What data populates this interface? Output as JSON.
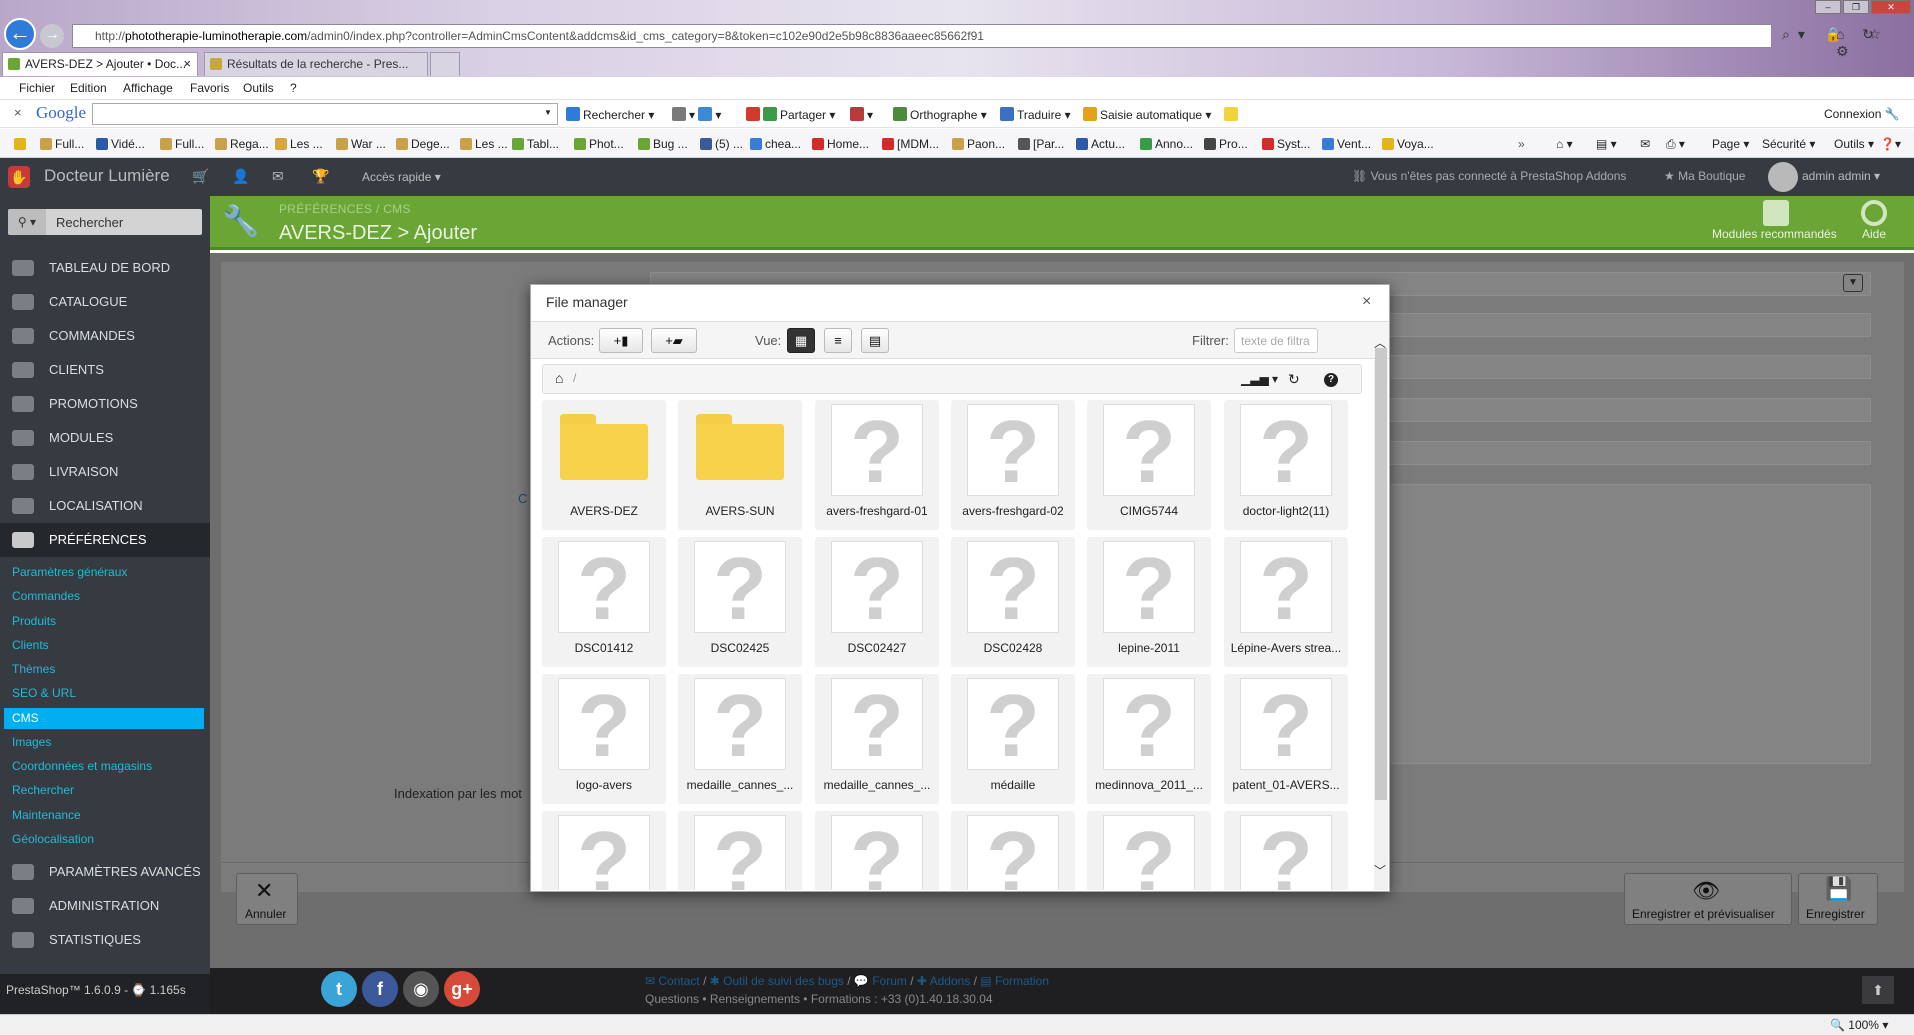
{
  "browser": {
    "url_prefix": "http://",
    "url_host": "phototherapie-luminotherapie.com",
    "url_path": "/admin0/index.php?controller=AdminCmsContent&addcms&id_cms_category=8&token=c102e90d2e5b98c8836aaeec85662f91",
    "tabs": [
      {
        "label": "AVERS-DEZ > Ajouter • Doc...",
        "active": true
      },
      {
        "label": "Résultats de la recherche - Pres...",
        "active": false
      }
    ],
    "tab_close": "×",
    "menu": [
      "Fichier",
      "Edition",
      "Affichage",
      "Favoris",
      "Outils",
      "?"
    ]
  },
  "google_toolbar": {
    "close": "×",
    "logo": "Google",
    "search_value": "",
    "tools": [
      "Rechercher",
      "Partager",
      "Orthographe",
      "Traduire",
      "Saisie automatique"
    ],
    "connexion": "Connexion"
  },
  "bookmarks": [
    "Full...",
    "Vidé...",
    "Full...",
    "Rega...",
    "Les ...",
    "War ...",
    "Dege...",
    "Les ...",
    "Tabl...",
    "Phot...",
    "Bug ...",
    "(5) ...",
    "chea...",
    "Home...",
    "[MDM...",
    "Paon...",
    "[Par...",
    "Actu...",
    "Anno...",
    "Pro...",
    "Syst...",
    "Vent...",
    "Voya..."
  ],
  "browser_right_tools": [
    "Page",
    "Sécurité",
    "Outils"
  ],
  "admin": {
    "shop_name": "Docteur Lumière",
    "quick_access": "Accès rapide",
    "addons_status": "Vous n'êtes pas connecté à PrestaShop Addons",
    "my_shop": "Ma Boutique",
    "user": "admin admin"
  },
  "sidebar": {
    "search_placeholder": "Rechercher",
    "items": [
      {
        "label": "TABLEAU DE BORD"
      },
      {
        "label": "CATALOGUE"
      },
      {
        "label": "COMMANDES"
      },
      {
        "label": "CLIENTS"
      },
      {
        "label": "PROMOTIONS"
      },
      {
        "label": "MODULES"
      },
      {
        "label": "LIVRAISON"
      },
      {
        "label": "LOCALISATION"
      },
      {
        "label": "PRÉFÉRENCES"
      },
      {
        "label": "PARAMÈTRES AVANCÉS"
      },
      {
        "label": "ADMINISTRATION"
      },
      {
        "label": "STATISTIQUES"
      }
    ],
    "sub_items": [
      "Paramètres généraux",
      "Commandes",
      "Produits",
      "Clients",
      "Thèmes",
      "SEO & URL",
      "CMS",
      "Images",
      "Coordonnées et magasins",
      "Rechercher",
      "Maintenance",
      "Géolocalisation"
    ],
    "version": "PrestaShop™ 1.6.0.9 - ⌚ 1.165s"
  },
  "page": {
    "breadcrumb": "PRÉFÉRENCES  /  CMS",
    "title": "AVERS-DEZ > Ajouter",
    "recommended_modules": "Modules recommandés",
    "help": "Aide",
    "label_indexation": "Indexation par les mot",
    "label_c": "C",
    "cancel": "Annuler",
    "save_preview": "Enregistrer et prévisualiser",
    "save": "Enregistrer"
  },
  "file_manager": {
    "title": "File manager",
    "close": "×",
    "actions_label": "Actions:",
    "view_label": "Vue:",
    "filter_label": "Filtrer:",
    "filter_placeholder": "texte de filtra",
    "path_slash": "/",
    "files": [
      {
        "name": "AVERS-DEZ",
        "type": "folder"
      },
      {
        "name": "AVERS-SUN",
        "type": "folder"
      },
      {
        "name": "avers-freshgard-01",
        "type": "file"
      },
      {
        "name": "avers-freshgard-02",
        "type": "file"
      },
      {
        "name": "CIMG5744",
        "type": "file"
      },
      {
        "name": "doctor-light2(11)",
        "type": "file"
      },
      {
        "name": "DSC01412",
        "type": "file"
      },
      {
        "name": "DSC02425",
        "type": "file"
      },
      {
        "name": "DSC02427",
        "type": "file"
      },
      {
        "name": "DSC02428",
        "type": "file"
      },
      {
        "name": "lepine-2011",
        "type": "file"
      },
      {
        "name": "Lépine-Avers strea...",
        "type": "file"
      },
      {
        "name": "logo-avers",
        "type": "file"
      },
      {
        "name": "medaille_cannes_...",
        "type": "file"
      },
      {
        "name": "medaille_cannes_...",
        "type": "file"
      },
      {
        "name": "médaille",
        "type": "file"
      },
      {
        "name": "medinnova_2011_...",
        "type": "file"
      },
      {
        "name": "patent_01-AVERS...",
        "type": "file"
      },
      {
        "name": "",
        "type": "file"
      },
      {
        "name": "",
        "type": "file"
      },
      {
        "name": "",
        "type": "file"
      },
      {
        "name": "",
        "type": "file"
      },
      {
        "name": "",
        "type": "file"
      },
      {
        "name": "",
        "type": "file"
      }
    ]
  },
  "footer": {
    "links": [
      "Contact",
      "Outil de suivi des bugs",
      "Forum",
      "Addons",
      "Formation"
    ],
    "contact_line": "Questions • Renseignements • Formations : +33 (0)1.40.18.30.04",
    "zoom": "100%"
  }
}
